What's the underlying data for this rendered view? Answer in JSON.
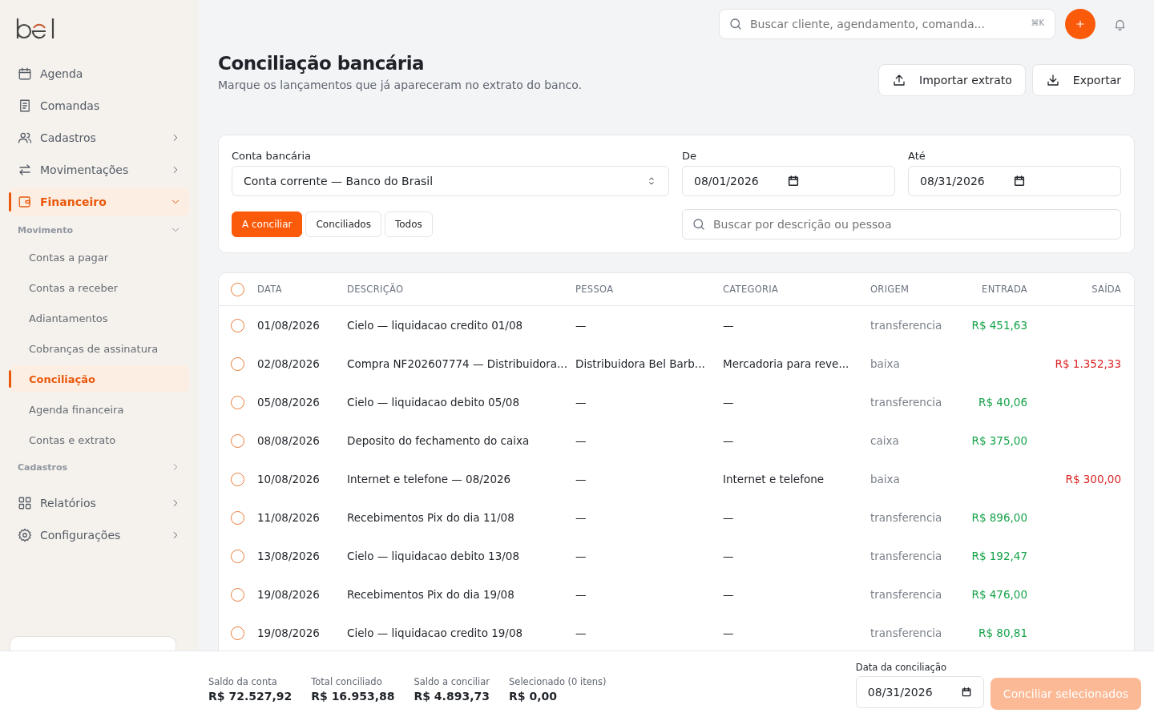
{
  "sidebar": {
    "items": [
      {
        "label": "Agenda",
        "kind": "link",
        "selected": false
      },
      {
        "label": "Comandas",
        "kind": "link",
        "selected": false
      },
      {
        "label": "Cadastros",
        "kind": "menu",
        "expanded": false,
        "selected": false
      },
      {
        "label": "Movimentações",
        "kind": "menu",
        "expanded": false,
        "selected": false
      },
      {
        "label": "Financeiro",
        "kind": "menu",
        "expanded": true,
        "selected": true
      }
    ],
    "groups": [
      {
        "label": "Movimento",
        "expanded": true,
        "items": [
          {
            "label": "Contas a pagar",
            "selected": false
          },
          {
            "label": "Contas a receber",
            "selected": false
          },
          {
            "label": "Adiantamentos",
            "selected": false
          },
          {
            "label": "Cobranças de assinatura",
            "selected": false
          },
          {
            "label": "Conciliação",
            "selected": true
          },
          {
            "label": "Agenda financeira",
            "selected": false
          },
          {
            "label": "Contas e extrato",
            "selected": false
          }
        ]
      },
      {
        "label": "Cadastros",
        "expanded": false
      }
    ],
    "bottom_items": [
      {
        "label": "Relatórios",
        "kind": "menu",
        "expanded": false,
        "selected": false
      },
      {
        "label": "Configurações",
        "kind": "menu",
        "expanded": false,
        "selected": false
      }
    ]
  },
  "topbar": {
    "search": {
      "placeholder": "Buscar cliente, agendamento, comanda...",
      "shortcut": "⌘K"
    }
  },
  "page": {
    "title": "Conciliação bancária",
    "subtitle": "Marque os lançamentos que já apareceram no extrato do banco.",
    "actions": [
      {
        "label": "Importar extrato"
      },
      {
        "label": "Exportar"
      }
    ]
  },
  "filters": {
    "account": {
      "label": "Conta bancária",
      "value": "Conta corrente — Banco do Brasil"
    },
    "from": {
      "label": "De",
      "value": "08/01/2026"
    },
    "to": {
      "label": "Até",
      "value": "08/31/2026"
    },
    "tabs": [
      {
        "label": "A conciliar",
        "selected": true
      },
      {
        "label": "Conciliados",
        "selected": false
      },
      {
        "label": "Todos",
        "selected": false
      }
    ],
    "search": {
      "placeholder": "Buscar por descrição ou pessoa"
    }
  },
  "table": {
    "all_checked": false,
    "columns": [
      "DATA",
      "DESCRIÇÃO",
      "PESSOA",
      "CATEGORIA",
      "ORIGEM",
      "ENTRADA",
      "SAÍDA"
    ],
    "rows": [
      {
        "checked": false,
        "date": "01/08/2026",
        "description": "Cielo — liquidacao credito 01/08",
        "person": "—",
        "category": "—",
        "origin": "transferencia",
        "in": "R$ 451,63"
      },
      {
        "checked": false,
        "date": "02/08/2026",
        "description": "Compra NF202607774 — Distribuidora...",
        "person": "Distribuidora Bel Barb...",
        "category": "Mercadoria para reve...",
        "origin": "baixa",
        "out": "R$ 1.352,33"
      },
      {
        "checked": false,
        "date": "05/08/2026",
        "description": "Cielo — liquidacao debito 05/08",
        "person": "—",
        "category": "—",
        "origin": "transferencia",
        "in": "R$ 40,06"
      },
      {
        "checked": false,
        "date": "08/08/2026",
        "description": "Deposito do fechamento do caixa",
        "person": "—",
        "category": "—",
        "origin": "caixa",
        "in": "R$ 375,00"
      },
      {
        "checked": false,
        "date": "10/08/2026",
        "description": "Internet e telefone — 08/2026",
        "person": "—",
        "category": "Internet e telefone",
        "origin": "baixa",
        "out": "R$ 300,00"
      },
      {
        "checked": false,
        "date": "11/08/2026",
        "description": "Recebimentos Pix do dia 11/08",
        "person": "—",
        "category": "—",
        "origin": "transferencia",
        "in": "R$ 896,00"
      },
      {
        "checked": false,
        "date": "13/08/2026",
        "description": "Cielo — liquidacao debito 13/08",
        "person": "—",
        "category": "—",
        "origin": "transferencia",
        "in": "R$ 192,47"
      },
      {
        "checked": false,
        "date": "19/08/2026",
        "description": "Recebimentos Pix do dia 19/08",
        "person": "—",
        "category": "—",
        "origin": "transferencia",
        "in": "R$ 476,00"
      },
      {
        "checked": false,
        "date": "19/08/2026",
        "description": "Cielo — liquidacao credito 19/08",
        "person": "—",
        "category": "—",
        "origin": "transferencia",
        "in": "R$ 80,81"
      }
    ]
  },
  "footer": {
    "stats": [
      {
        "label": "Saldo da conta",
        "value": "R$ 72.527,92"
      },
      {
        "label": "Total conciliado",
        "value": "R$ 16.953,88"
      },
      {
        "label": "Saldo a conciliar",
        "value": "R$ 4.893,73"
      },
      {
        "label": "Selecionado (0 itens)",
        "value": "R$ 0,00"
      }
    ],
    "date": {
      "label": "Data da conciliação",
      "value": "08/31/2026"
    },
    "button": {
      "label": "Conciliar selecionados",
      "disabled": true
    }
  }
}
